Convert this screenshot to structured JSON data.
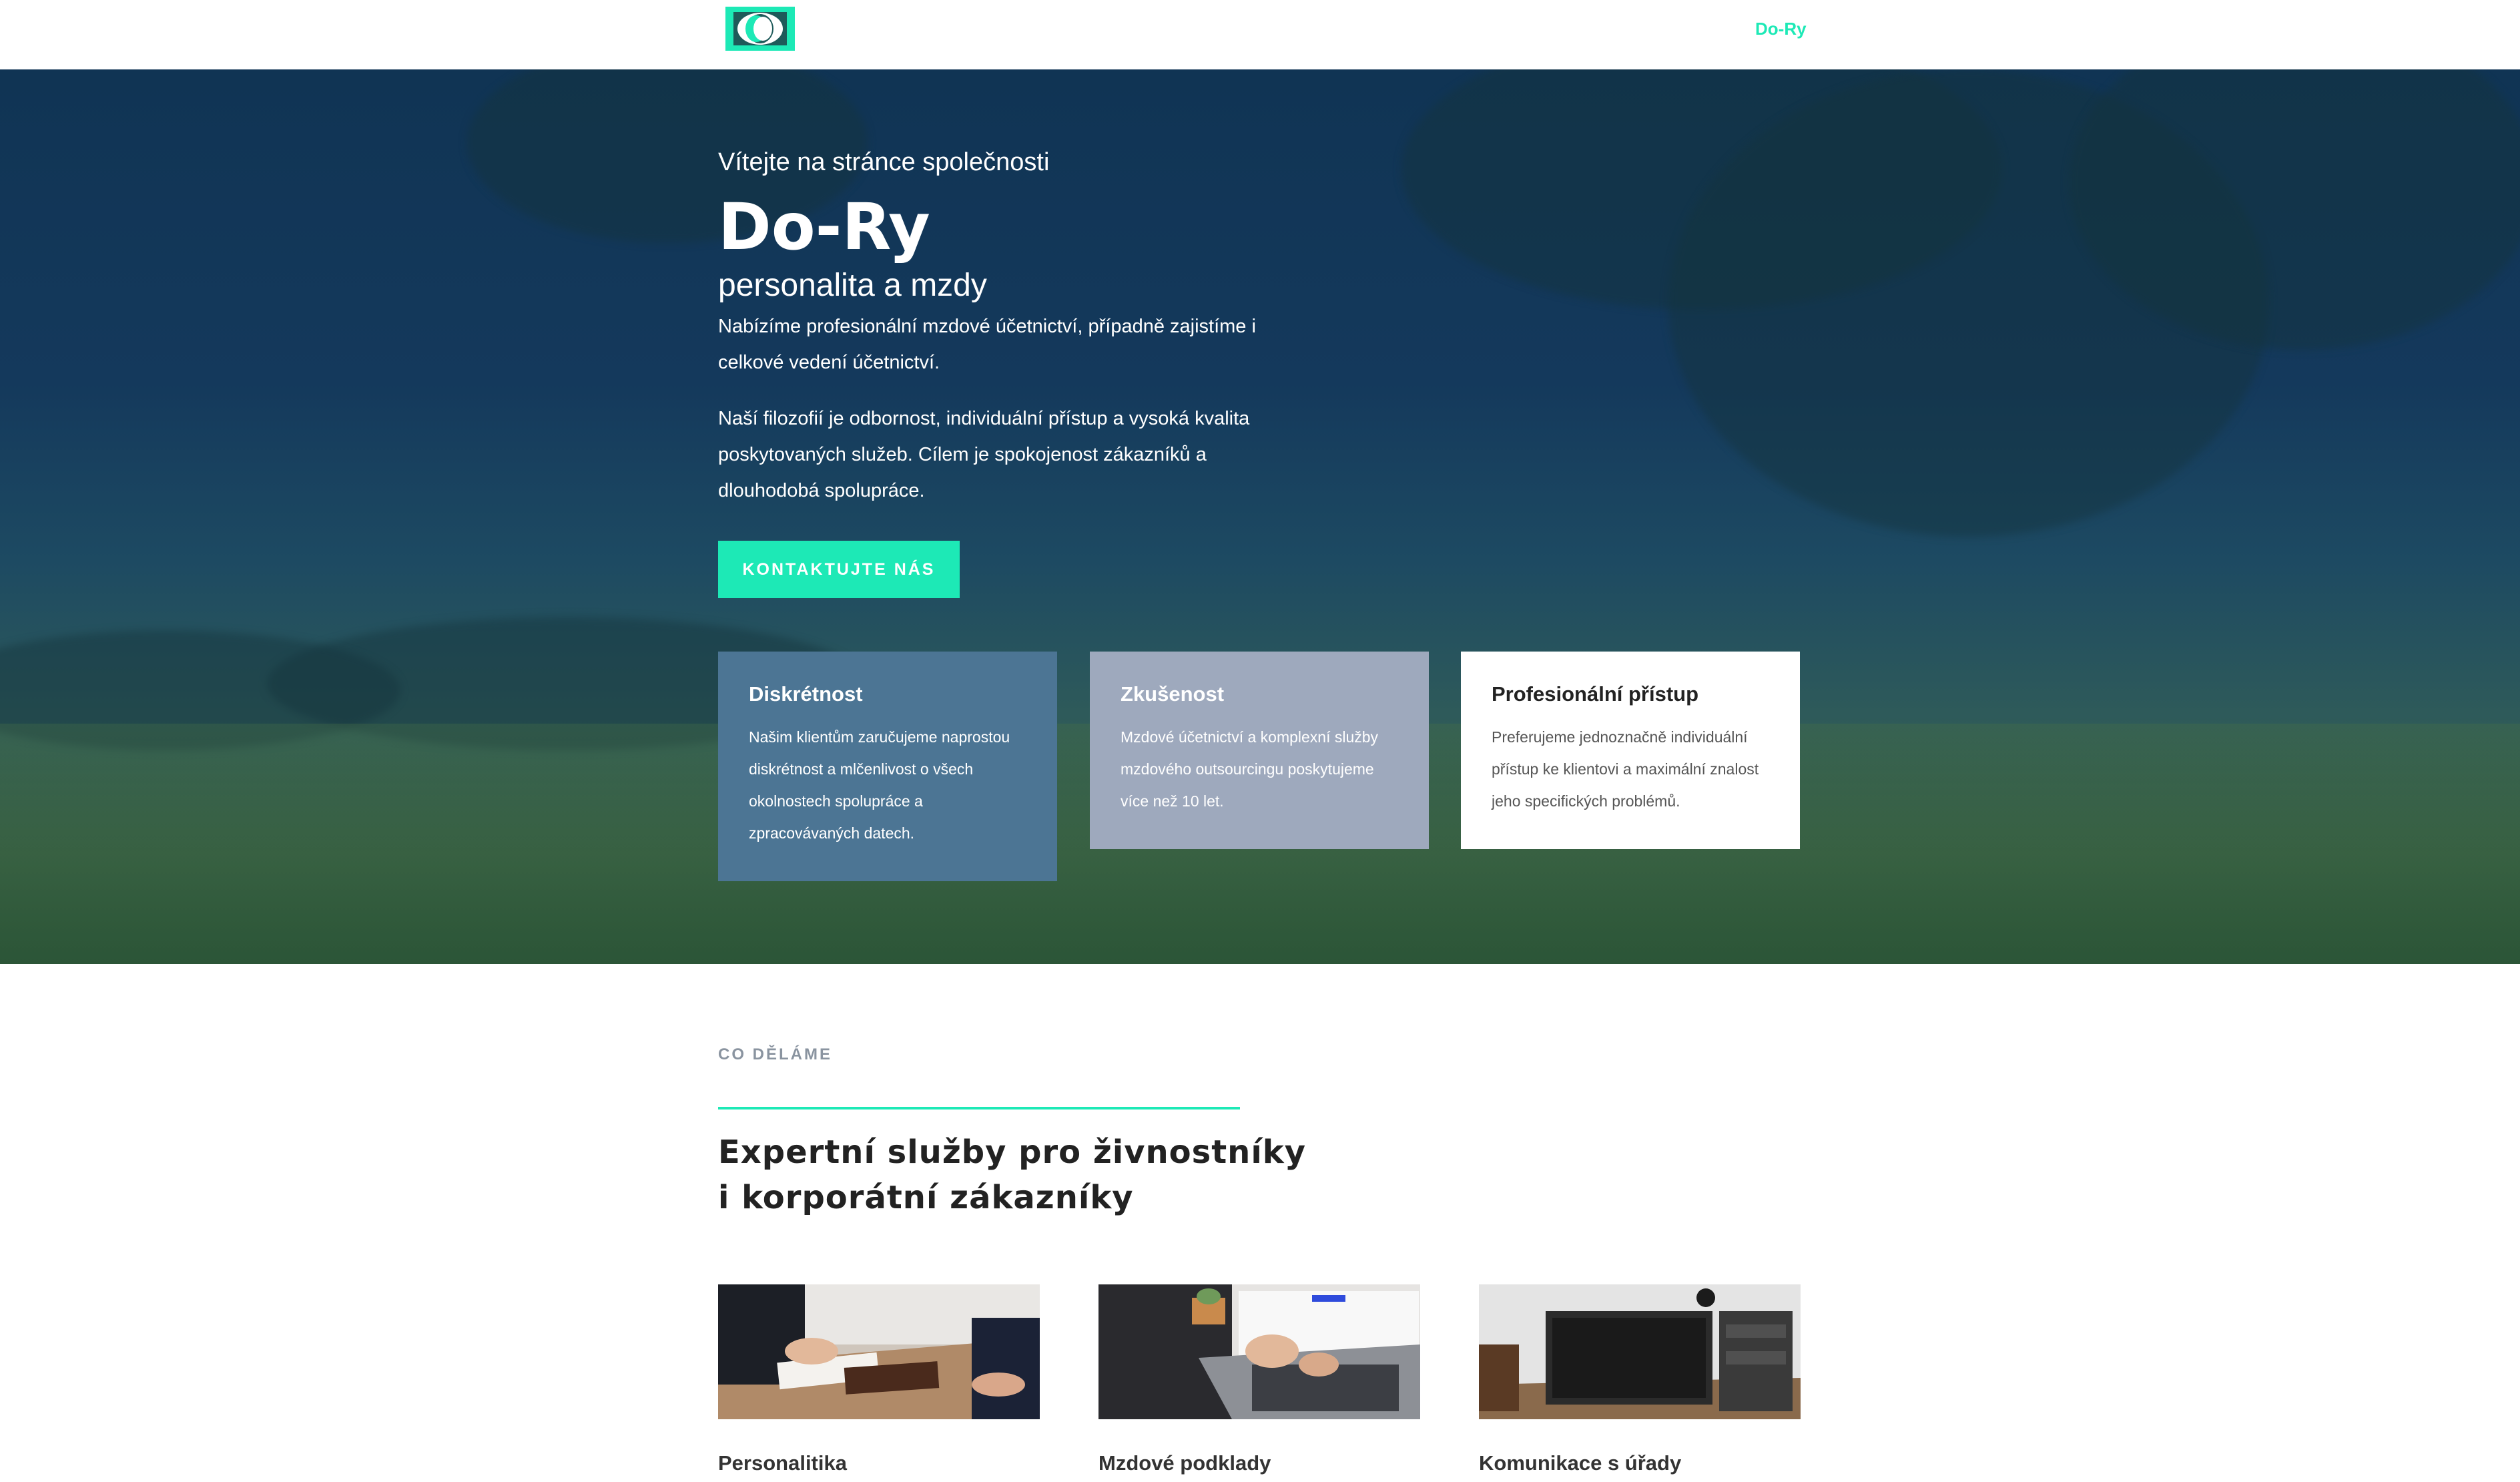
{
  "nav": {
    "logo": "Do-Ry logo",
    "link": "Do-Ry"
  },
  "hero": {
    "welcome": "Vítejte na stránce společnosti",
    "title": "Do-Ry",
    "subtitle": "personalita a mzdy",
    "p1": "Nabízíme profesionální mzdové účetnictví, případně zajistíme i celkové vedení účetnictví.",
    "p2": "Naší filozofií je odbornost, individuální přístup a vysoká kvalita poskytovaných služeb. Cílem je spokojenost zákazníků a dlouhodobá spolupráce.",
    "cta": "KONTAKTUJTE NÁS"
  },
  "features": [
    {
      "title": "Diskrétnost",
      "text": "Našim klientům zaručujeme naprostou diskrétnost a mlčenlivost o všech okolnostech spolupráce a zpracovávaných datech."
    },
    {
      "title": "Zkušenost",
      "text": "Mzdové účetnictví a komplexní služby mzdového outsourcingu poskytujeme více než 10 let."
    },
    {
      "title": "Profesionální přístup",
      "text": "Preferujeme jednoznačně individuální přístup ke klientovi a maximální znalost jeho specifických problémů."
    }
  ],
  "services_section": {
    "label": "CO DĚLÁME",
    "heading_line1": "Expertní služby pro živnostníky",
    "heading_line2": "i korporátní zákazníky",
    "items": [
      {
        "title": "Personalitika"
      },
      {
        "title": "Mzdové podklady"
      },
      {
        "title": "Komunikace s úřady"
      }
    ]
  },
  "colors": {
    "accent": "#1de9b6",
    "card1": "#4c7594",
    "card2": "#9ea9bd",
    "hero_dark": "#103454"
  }
}
